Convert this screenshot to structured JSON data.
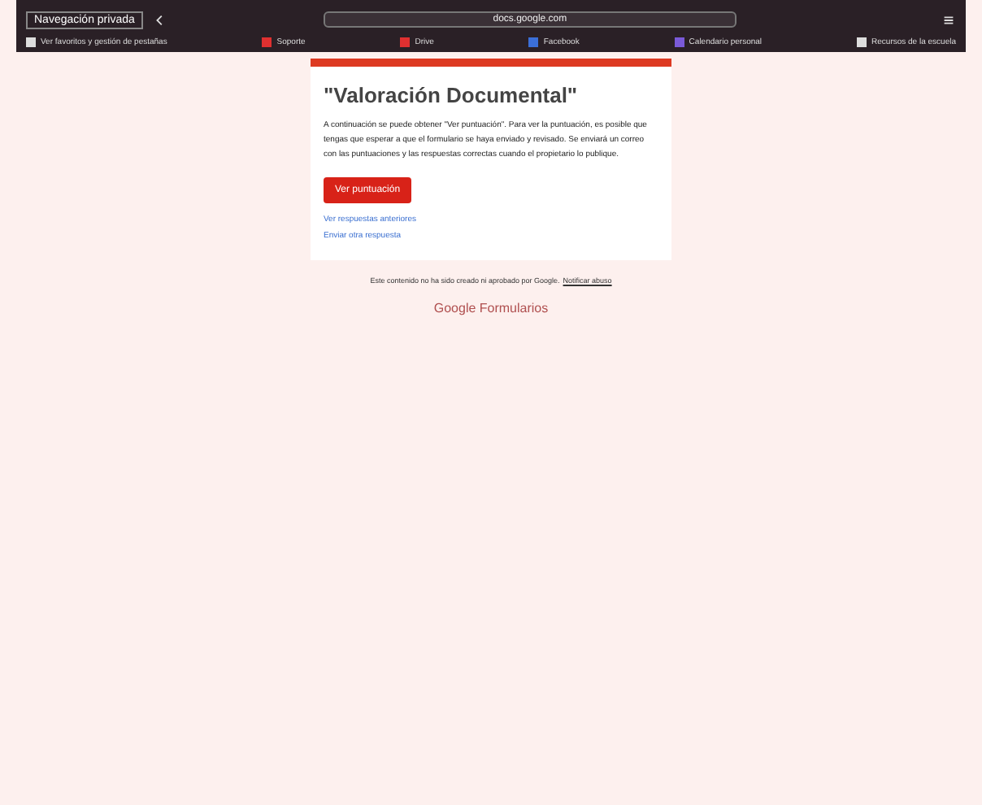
{
  "browser": {
    "tab_title": "Navegación privada",
    "address": "docs.google.com"
  },
  "bookmarks": [
    {
      "label": "Ver favoritos y gestión de pestañas",
      "color": "#dddddd"
    },
    {
      "label": "Soporte",
      "color": "#e03030"
    },
    {
      "label": "Drive",
      "color": "#e03030"
    },
    {
      "label": "Facebook",
      "color": "#3b6fd8"
    },
    {
      "label": "Calendario personal",
      "color": "#7a5ad8"
    },
    {
      "label": "Recursos de la escuela",
      "color": "#dddddd"
    }
  ],
  "form": {
    "title": "\"Valoración Documental\"",
    "message": "A continuación se puede obtener \"Ver puntuación\". Para ver la puntuación, es posible que tengas que esperar a que el formulario se haya enviado y revisado. Se enviará un correo con las puntuaciones y las respuestas correctas cuando el propietario lo publique.",
    "button": "Ver puntuación",
    "links": [
      "Ver respuestas anteriores",
      "Enviar otra respuesta"
    ]
  },
  "footer": {
    "note": "Este contenido no ha sido creado ni aprobado por Google.",
    "link": "Notificar abuso",
    "brand": "Google Formularios"
  }
}
